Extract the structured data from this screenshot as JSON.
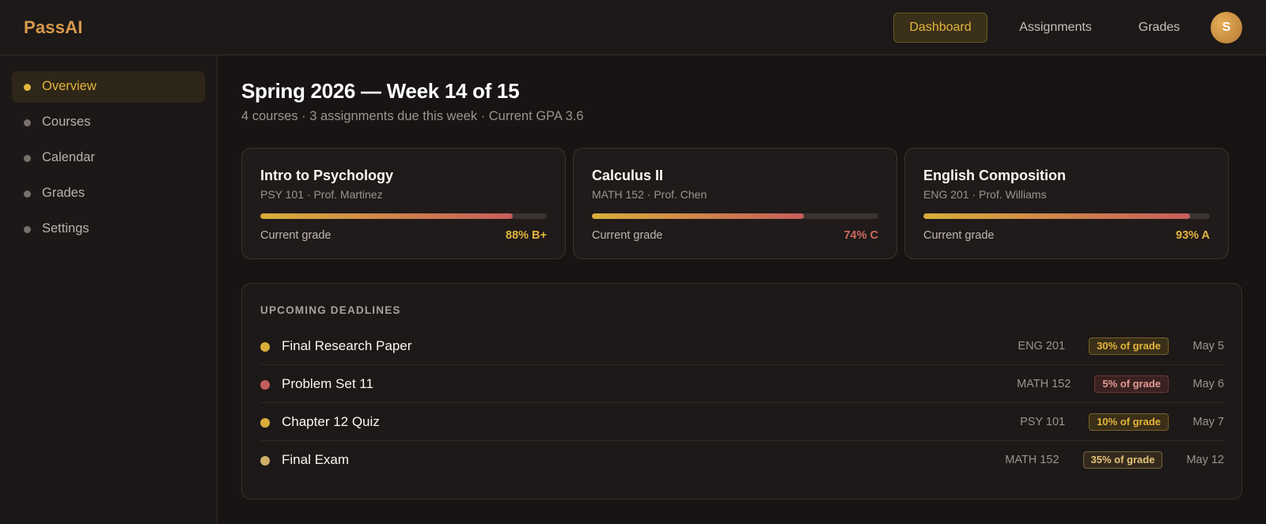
{
  "brand": "PassAI",
  "nav": {
    "items": [
      "Dashboard",
      "Assignments",
      "Grades"
    ],
    "avatar_initial": "S"
  },
  "sidebar": {
    "items": [
      {
        "label": "Overview",
        "active": true
      },
      {
        "label": "Courses",
        "active": false
      },
      {
        "label": "Calendar",
        "active": false
      },
      {
        "label": "Grades",
        "active": false
      },
      {
        "label": "Settings",
        "active": false
      }
    ]
  },
  "header": {
    "title": "Spring 2026 — Week 14 of 15",
    "subtitle": "4 courses · 3 assignments due this week · Current GPA 3.6"
  },
  "courses": [
    {
      "title": "Intro to Psychology",
      "sub": "PSY 101 · Prof. Martinez",
      "progress": 0.88,
      "grade_label": "Current grade",
      "grade": "88% B+",
      "grade_color": "#e3b53c"
    },
    {
      "title": "Calculus II",
      "sub": "MATH 152 · Prof. Chen",
      "progress": 0.74,
      "grade_label": "Current grade",
      "grade": "74% C",
      "grade_color": "#d06a63"
    },
    {
      "title": "English Composition",
      "sub": "ENG 201 · Prof. Williams",
      "progress": 0.93,
      "grade_label": "Current grade",
      "grade": "93% A",
      "grade_color": "#e3b53c"
    }
  ],
  "deadlines": {
    "heading": "UPCOMING DEADLINES",
    "items": [
      {
        "name": "Final Research Paper",
        "course": "ENG 201",
        "weight": "30% of grade",
        "date": "May 5",
        "dot_color": "#d9ae3a",
        "badge_text": "#e3b53c",
        "badge_bg": "#3a2f18",
        "badge_border": "#7a6128"
      },
      {
        "name": "Problem Set 11",
        "course": "MATH 152",
        "weight": "5% of grade",
        "date": "May 6",
        "dot_color": "#c55d5b",
        "badge_text": "#e39a94",
        "badge_bg": "#3a2221",
        "badge_border": "#6d3735"
      },
      {
        "name": "Chapter 12 Quiz",
        "course": "PSY 101",
        "weight": "10% of grade",
        "date": "May 7",
        "dot_color": "#d9ae3a",
        "badge_text": "#e3b53c",
        "badge_bg": "#3a2f18",
        "badge_border": "#7a6128"
      },
      {
        "name": "Final Exam",
        "course": "MATH 152",
        "weight": "35% of grade",
        "date": "May 12",
        "dot_color": "#cfae6a",
        "badge_text": "#e6c27a",
        "badge_bg": "#332a1d",
        "badge_border": "#77633c"
      }
    ]
  }
}
